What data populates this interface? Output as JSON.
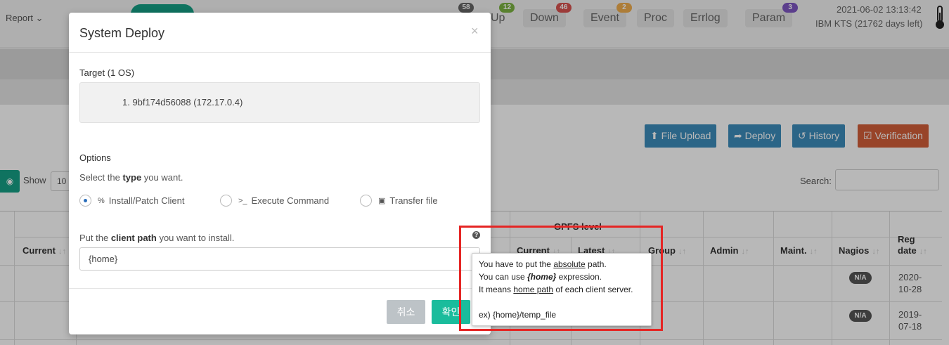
{
  "header": {
    "report_menu": "Report",
    "tabs": [
      {
        "label": "Up",
        "badge": "12"
      },
      {
        "label": "Down",
        "badge": "46"
      },
      {
        "label": "Event",
        "badge": "2"
      },
      {
        "label": "Proc",
        "badge": ""
      },
      {
        "label": "Errlog",
        "badge": ""
      },
      {
        "label": "Param",
        "badge": "3"
      }
    ],
    "first_badge": "58",
    "datetime": "2021-06-02 13:13:42",
    "license": "IBM KTS (21762 days left)"
  },
  "toolbar": {
    "file_upload": "File Upload",
    "deploy": "Deploy",
    "history": "History",
    "verification": "Verification"
  },
  "table_controls": {
    "show_label": "Show",
    "show_value": "10",
    "search_label": "Search:"
  },
  "table": {
    "gpfs_header": "GPFS level",
    "headers": [
      "Current",
      "Current",
      "Latest",
      "Group",
      "Admin",
      "Maint.",
      "Nagios",
      "Reg date"
    ],
    "rows": [
      {
        "nagios": "N/A",
        "reg_date": "2020-10-28"
      },
      {
        "nagios": "N/A",
        "reg_date": "2019-07-18"
      }
    ]
  },
  "modal": {
    "title": "System Deploy",
    "close": "×",
    "target_label": "Target (1 OS)",
    "target_item": "1. 9bf174d56088 (172.17.0.4)",
    "options_label": "Options",
    "type_hint_prefix": "Select the ",
    "type_hint_bold": "type",
    "type_hint_suffix": " you want.",
    "options": [
      {
        "label": "Install/Patch Client",
        "selected": true
      },
      {
        "label": "Execute Command",
        "selected": false
      },
      {
        "label": "Transfer file",
        "selected": false
      }
    ],
    "path_hint_prefix": "Put the ",
    "path_hint_bold": "client path",
    "path_hint_suffix": " you want to install.",
    "path_value": "{home}",
    "cancel_label": "취소",
    "ok_label": "확인"
  },
  "tooltip": {
    "l1_a": "You have to put the ",
    "l1_u": "absolute",
    "l1_b": " path.",
    "l2_a": "You can use ",
    "l2_em": "{home}",
    "l2_b": " expression.",
    "l3_a": "It means ",
    "l3_u": "home path",
    "l3_b": " of each client server.",
    "example": "ex) {home}/temp_file"
  },
  "colors": {
    "accent_teal": "#1abc9c",
    "button_blue": "#3c8dbc",
    "button_orange": "#d35f3a",
    "highlight_red": "#e52524"
  }
}
